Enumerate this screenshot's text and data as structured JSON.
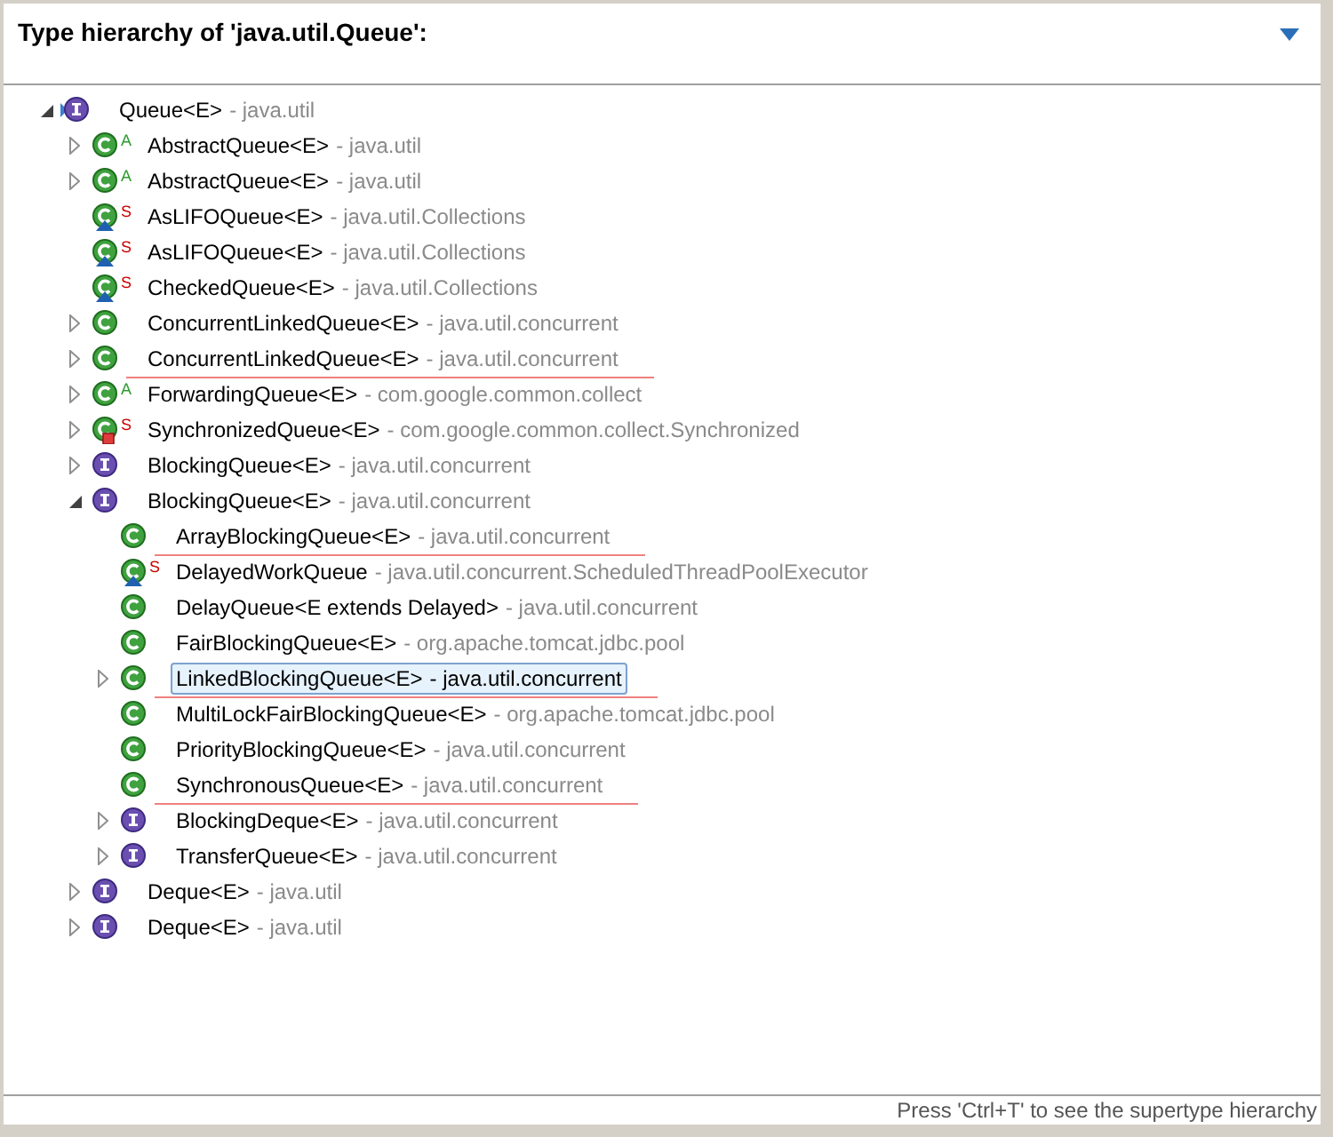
{
  "header": {
    "title": "Type hierarchy of 'java.util.Queue':"
  },
  "tree": [
    {
      "kind": "interface",
      "name": "Queue<E>",
      "package": "- java.util",
      "focus": true,
      "expanded": true,
      "selected": false,
      "underlined": false,
      "children": [
        {
          "kind": "class",
          "modifier": "A",
          "name": "AbstractQueue<E>",
          "package": "- java.util",
          "expanded": false,
          "selected": false,
          "underlined": false
        },
        {
          "kind": "class",
          "modifier": "A",
          "name": "AbstractQueue<E>",
          "package": "- java.util",
          "expanded": false,
          "selected": false,
          "underlined": false
        },
        {
          "kind": "class",
          "modifier": "S",
          "package_private": true,
          "name": "AsLIFOQueue<E>",
          "package": "- java.util.Collections",
          "selected": false,
          "underlined": false
        },
        {
          "kind": "class",
          "modifier": "S",
          "package_private": true,
          "name": "AsLIFOQueue<E>",
          "package": "- java.util.Collections",
          "selected": false,
          "underlined": false
        },
        {
          "kind": "class",
          "modifier": "S",
          "package_private": true,
          "name": "CheckedQueue<E>",
          "package": "- java.util.Collections",
          "selected": false,
          "underlined": false
        },
        {
          "kind": "class",
          "name": "ConcurrentLinkedQueue<E>",
          "package": "- java.util.concurrent",
          "expanded": false,
          "selected": false,
          "underlined": false
        },
        {
          "kind": "class",
          "name": "ConcurrentLinkedQueue<E>",
          "package": "- java.util.concurrent",
          "expanded": false,
          "selected": false,
          "underlined": true
        },
        {
          "kind": "class",
          "modifier": "A",
          "name": "ForwardingQueue<E>",
          "package": "- com.google.common.collect",
          "expanded": false,
          "selected": false,
          "underlined": false
        },
        {
          "kind": "class",
          "modifier": "S",
          "private": true,
          "name": "SynchronizedQueue<E>",
          "package": "- com.google.common.collect.Synchronized",
          "expanded": false,
          "selected": false,
          "underlined": false
        },
        {
          "kind": "interface",
          "name": "BlockingQueue<E>",
          "package": "- java.util.concurrent",
          "expanded": false,
          "selected": false,
          "underlined": false
        },
        {
          "kind": "interface",
          "name": "BlockingQueue<E>",
          "package": "- java.util.concurrent",
          "expanded": true,
          "selected": false,
          "underlined": false,
          "children": [
            {
              "kind": "class",
              "name": "ArrayBlockingQueue<E>",
              "package": "- java.util.concurrent",
              "selected": false,
              "underlined": true
            },
            {
              "kind": "class",
              "modifier": "S",
              "package_private": true,
              "name": "DelayedWorkQueue",
              "package": "- java.util.concurrent.ScheduledThreadPoolExecutor",
              "selected": false,
              "underlined": false
            },
            {
              "kind": "class",
              "name": "DelayQueue<E extends Delayed>",
              "package": "- java.util.concurrent",
              "selected": false,
              "underlined": false
            },
            {
              "kind": "class",
              "name": "FairBlockingQueue<E>",
              "package": "- org.apache.tomcat.jdbc.pool",
              "selected": false,
              "underlined": false
            },
            {
              "kind": "class",
              "name": "LinkedBlockingQueue<E>",
              "package": "- java.util.concurrent",
              "expanded": false,
              "selected": true,
              "underlined": true
            },
            {
              "kind": "class",
              "name": "MultiLockFairBlockingQueue<E>",
              "package": "- org.apache.tomcat.jdbc.pool",
              "selected": false,
              "underlined": false
            },
            {
              "kind": "class",
              "name": "PriorityBlockingQueue<E>",
              "package": "- java.util.concurrent",
              "selected": false,
              "underlined": false
            },
            {
              "kind": "class",
              "name": "SynchronousQueue<E>",
              "package": "- java.util.concurrent",
              "selected": false,
              "underlined": true
            },
            {
              "kind": "interface",
              "name": "BlockingDeque<E>",
              "package": "- java.util.concurrent",
              "expanded": false,
              "selected": false,
              "underlined": false
            },
            {
              "kind": "interface",
              "name": "TransferQueue<E>",
              "package": "- java.util.concurrent",
              "expanded": false,
              "selected": false,
              "underlined": false
            }
          ]
        },
        {
          "kind": "interface",
          "name": "Deque<E>",
          "package": "- java.util",
          "expanded": false,
          "selected": false,
          "underlined": false
        },
        {
          "kind": "interface",
          "name": "Deque<E>",
          "package": "- java.util",
          "expanded": false,
          "selected": false,
          "underlined": false
        }
      ]
    }
  ],
  "status_bar": "Press 'Ctrl+T' to see the supertype hierarchy"
}
